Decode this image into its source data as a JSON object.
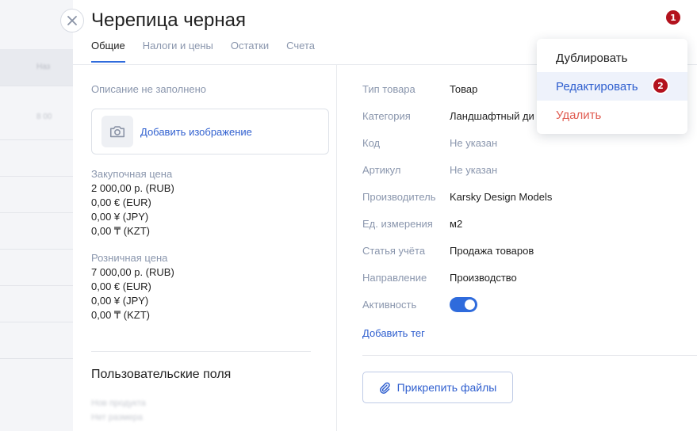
{
  "background": {
    "header_text": "Наз",
    "cell_text": "8 00"
  },
  "header": {
    "title": "Черепица черная",
    "close_icon": "close-icon"
  },
  "tabs": [
    {
      "label": "Общие",
      "active": true
    },
    {
      "label": "Налоги и цены",
      "active": false
    },
    {
      "label": "Остатки",
      "active": false
    },
    {
      "label": "Счета",
      "active": false
    }
  ],
  "left": {
    "description": "Описание не заполнено",
    "add_image": "Добавить изображение",
    "image_icon": "camera-icon",
    "purchase": {
      "label": "Закупочная цена",
      "values": [
        "2 000,00 р. (RUB)",
        "0,00 € (EUR)",
        "0,00 ¥ (JPY)",
        "0,00 ₸ (KZT)"
      ]
    },
    "retail": {
      "label": "Розничная цена",
      "values": [
        "7 000,00 р. (RUB)",
        "0,00 € (EUR)",
        "0,00 ¥ (JPY)",
        "0,00 ₸ (KZT)"
      ]
    },
    "custom_fields_title": "Пользовательские поля",
    "custom_fields_blurred": [
      "Нов продукта",
      "Нет размера"
    ]
  },
  "properties": [
    {
      "key": "Тип товара",
      "value": "Товар",
      "muted": false
    },
    {
      "key": "Категория",
      "value": "Ландшафтный ди",
      "muted": false
    },
    {
      "key": "Код",
      "value": "Не указан",
      "muted": true
    },
    {
      "key": "Артикул",
      "value": "Не указан",
      "muted": true
    },
    {
      "key": "Производитель",
      "value": "Karsky Design Models",
      "muted": false
    },
    {
      "key": "Ед. измерения",
      "value": "м2",
      "muted": false
    },
    {
      "key": "Статья учёта",
      "value": "Продажа товаров",
      "muted": false
    },
    {
      "key": "Направление",
      "value": "Производство",
      "muted": false
    },
    {
      "key": "Активность",
      "value": "",
      "muted": false
    }
  ],
  "activity_enabled": true,
  "add_tag": "Добавить тег",
  "attach_files": "Прикрепить файлы",
  "attach_icon": "paperclip-icon",
  "menu": {
    "items": [
      {
        "label": "Дублировать",
        "color": "#222222",
        "highlighted": false
      },
      {
        "label": "Редактировать",
        "color": "#2f5fcf",
        "highlighted": true
      },
      {
        "label": "Удалить",
        "color": "#e05b50",
        "highlighted": false
      }
    ]
  },
  "badges": [
    "1",
    "2"
  ],
  "colors": {
    "accent": "#2f6bdc",
    "link": "#2f5fcf",
    "danger": "#e05b50",
    "badge": "#b3121d"
  }
}
